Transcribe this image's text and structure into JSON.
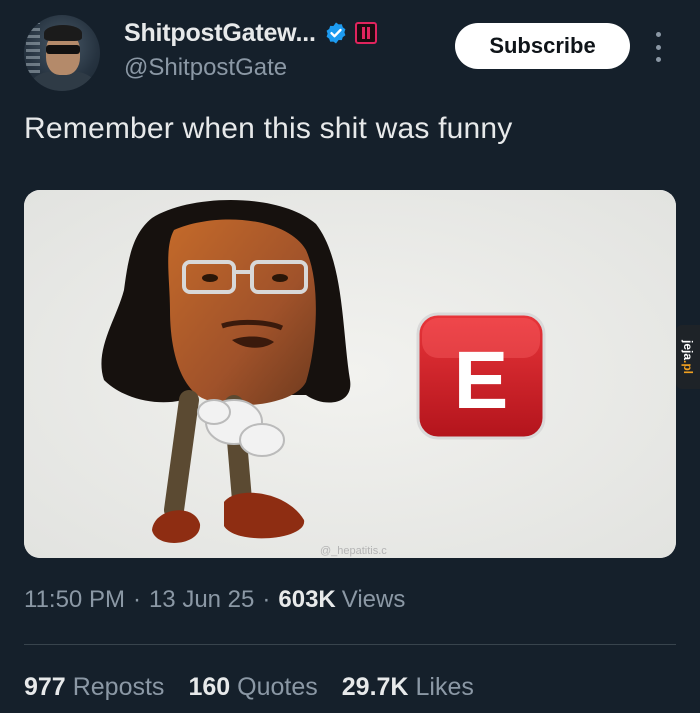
{
  "author": {
    "display_name": "ShitpostGatew...",
    "handle": "@ShitpostGate",
    "verified": true,
    "accent_color": "#1d9bf0",
    "affiliate_badge_color": "#e0245e"
  },
  "actions": {
    "subscribe_label": "Subscribe",
    "more_icon": "more-vertical-icon"
  },
  "tweet": {
    "text": "Remember when this shit was funny"
  },
  "media": {
    "watermark": "@_hepatitis.c",
    "emoji_letter": "E"
  },
  "overlay": {
    "site_tab": "jeja.pl"
  },
  "meta": {
    "time": "11:50 PM",
    "date": "13 Jun 25",
    "views_count": "603K",
    "views_label": "Views"
  },
  "stats": {
    "reposts_count": "977",
    "reposts_label": "Reposts",
    "quotes_count": "160",
    "quotes_label": "Quotes",
    "likes_count": "29.7K",
    "likes_label": "Likes"
  }
}
